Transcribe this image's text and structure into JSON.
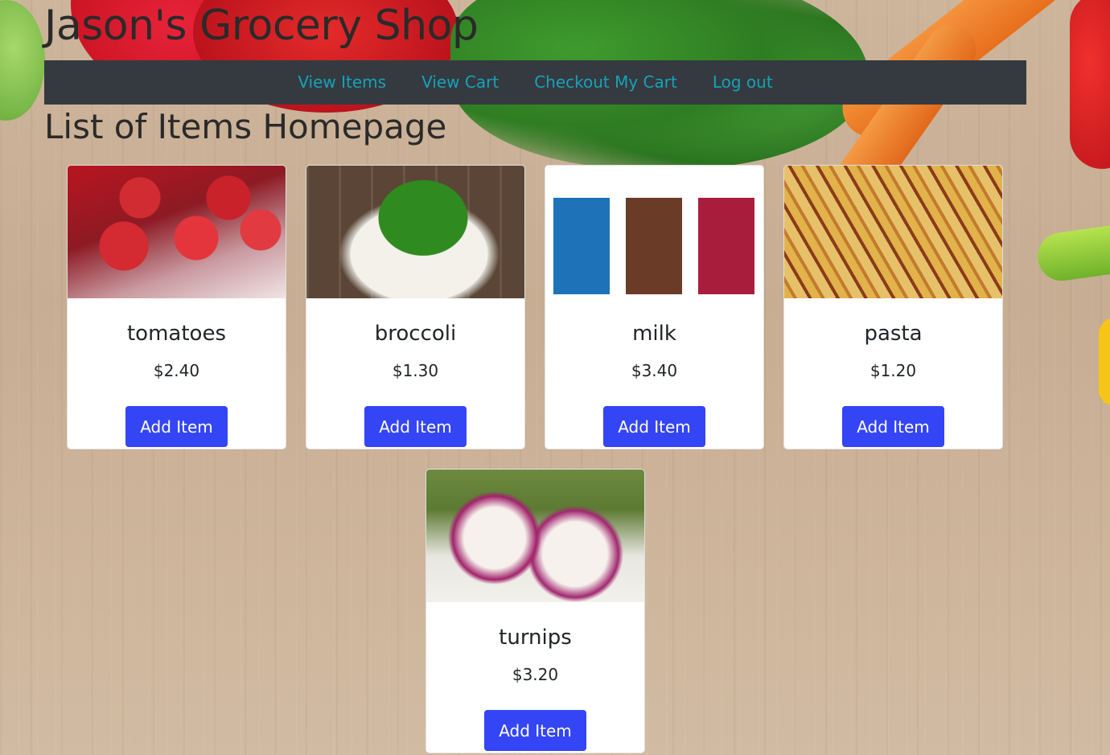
{
  "header": {
    "title": "Jason's Grocery Shop"
  },
  "nav": {
    "items": [
      "View Items",
      "View Cart",
      "Checkout My Cart",
      "Log out"
    ]
  },
  "page": {
    "heading": "List of Items Homepage"
  },
  "products": [
    {
      "name": "tomatoes",
      "price": "$2.40",
      "button": "Add Item"
    },
    {
      "name": "broccoli",
      "price": "$1.30",
      "button": "Add Item"
    },
    {
      "name": "milk",
      "price": "$3.40",
      "button": "Add Item"
    },
    {
      "name": "pasta",
      "price": "$1.20",
      "button": "Add Item"
    },
    {
      "name": "turnips",
      "price": "$3.20",
      "button": "Add Item"
    }
  ],
  "colors": {
    "navbar_bg": "#343a40",
    "nav_link": "#17a2b8",
    "button_bg": "#3445f5"
  }
}
